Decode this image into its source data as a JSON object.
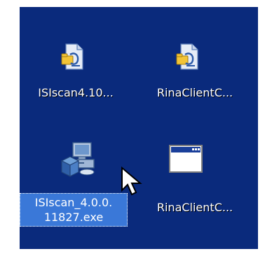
{
  "desktop": {
    "icons": [
      {
        "label": "ISIscan4.10...",
        "icon": "script-file-icon"
      },
      {
        "label": "RinaClientC...",
        "icon": "script-file-icon"
      },
      {
        "label_line1": "ISIscan_4.0.0.",
        "label_line2": "11827.exe",
        "icon": "installer-icon",
        "selected": true
      },
      {
        "label": "RinaClientC...",
        "icon": "application-window-icon"
      }
    ]
  }
}
